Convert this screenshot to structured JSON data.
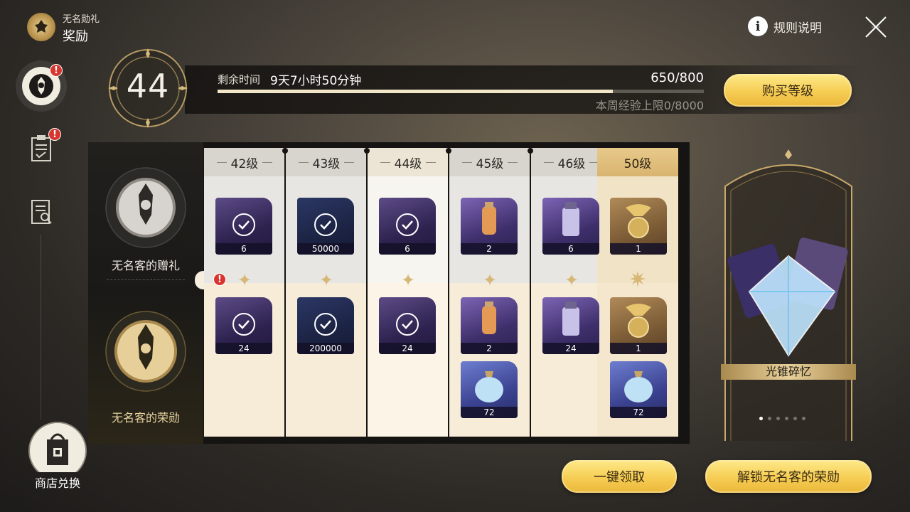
{
  "header": {
    "subtitle": "无名勋礼",
    "title": "奖励",
    "rules_label": "规则说明"
  },
  "nav": {
    "badge_text": "!",
    "shop_label": "商店兑换"
  },
  "level": {
    "current": "44",
    "time_label": "剩余时间",
    "time_value": "9天7小时50分钟",
    "exp_value": "650/800",
    "exp_progress": 0.8125,
    "weekly_cap": "本周经验上限0/8000",
    "buy_button": "购买等级"
  },
  "tracks": {
    "free_label": "无名客的赠礼",
    "paid_label": "无名客的荣勋"
  },
  "columns": [
    {
      "level": "42级",
      "free": {
        "qty": "6",
        "claimed": true,
        "art": "purple"
      },
      "paid": [
        {
          "qty": "24",
          "claimed": true,
          "art": "purple"
        }
      ]
    },
    {
      "level": "43级",
      "free": {
        "qty": "50000",
        "claimed": true,
        "art": "navy"
      },
      "paid": [
        {
          "qty": "200000",
          "claimed": true,
          "art": "navy"
        }
      ]
    },
    {
      "level": "44级",
      "free": {
        "qty": "6",
        "claimed": true,
        "art": "purple"
      },
      "paid": [
        {
          "qty": "24",
          "claimed": true,
          "art": "purple"
        }
      ]
    },
    {
      "level": "45级",
      "free": {
        "qty": "2",
        "claimed": false,
        "art": "purple"
      },
      "paid": [
        {
          "qty": "2",
          "claimed": false,
          "art": "purple"
        },
        {
          "qty": "72",
          "claimed": false,
          "art": "blue"
        }
      ]
    },
    {
      "level": "46级",
      "free": {
        "qty": "6",
        "claimed": false,
        "art": "purple"
      },
      "paid": [
        {
          "qty": "24",
          "claimed": false,
          "art": "purple"
        }
      ]
    },
    {
      "level": "50级",
      "free": {
        "qty": "1",
        "claimed": false,
        "art": "gold"
      },
      "paid": [
        {
          "qty": "1",
          "claimed": false,
          "art": "gold"
        },
        {
          "qty": "72",
          "claimed": false,
          "art": "blue"
        }
      ]
    }
  ],
  "reward_card": {
    "label": "光锥碎忆",
    "page_dots": 6,
    "active_dot": 0
  },
  "actions": {
    "claim_all": "一键领取",
    "unlock": "解锁无名客的荣勋"
  },
  "colors": {
    "gold_button": "#f6cd53",
    "badge_red": "#d8352f",
    "panel_cream": "#f6ecd8"
  },
  "icons": {
    "check": "check-circle-icon",
    "star": "compass-star-icon"
  }
}
